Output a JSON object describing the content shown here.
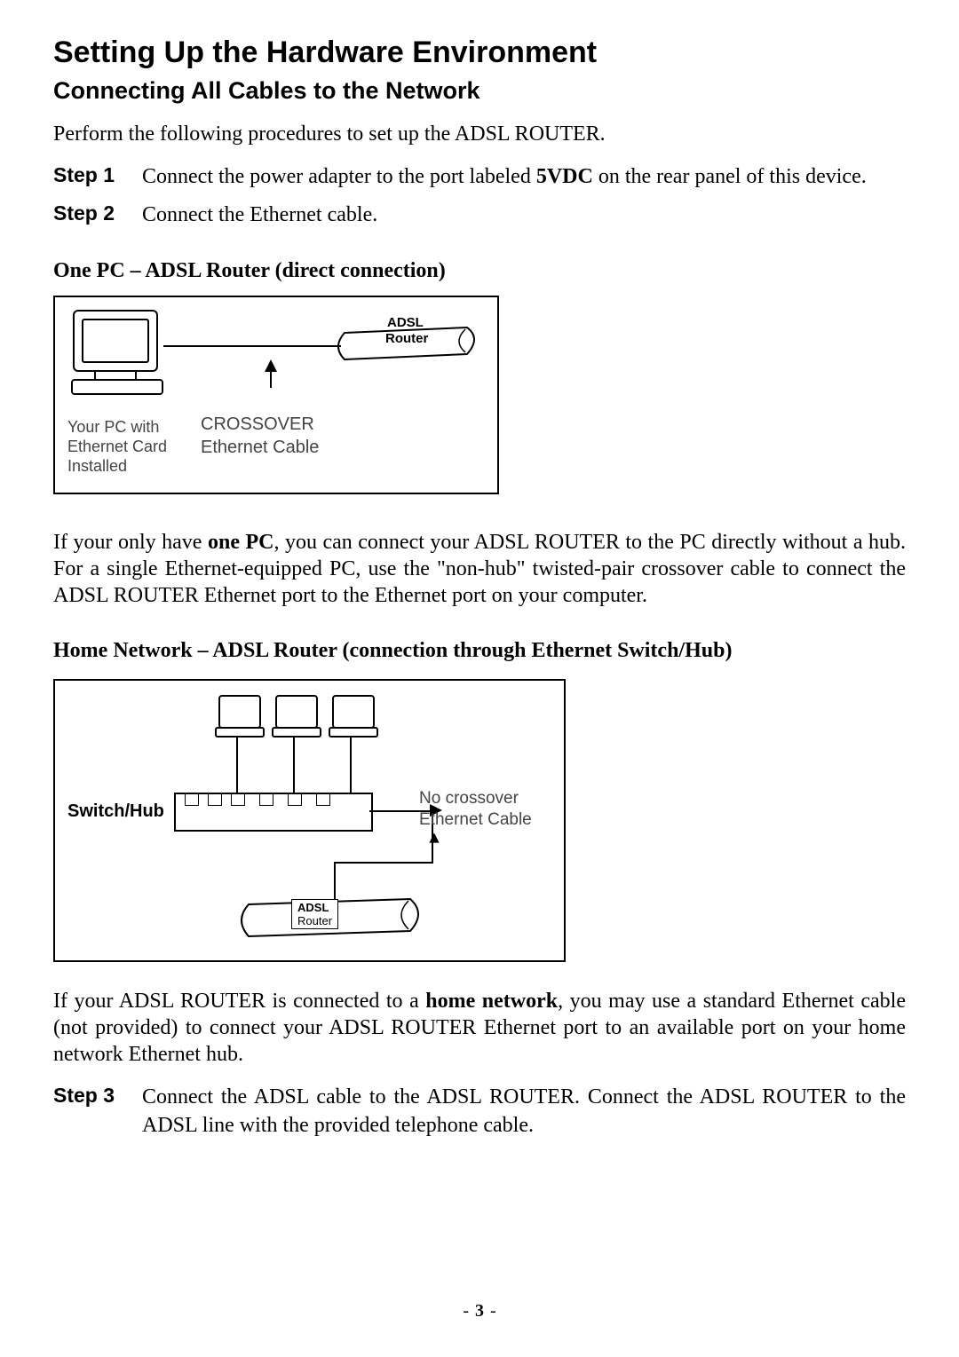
{
  "title": "Setting Up the Hardware Environment",
  "subtitle": "Connecting All Cables to the Network",
  "intro": "Perform the following procedures to set up the ADSL ROUTER.",
  "steps": {
    "s1": {
      "label": "Step 1",
      "text_before": "Connect the power adapter to the port labeled ",
      "bold": "5VDC",
      "text_after": " on the rear panel of this device."
    },
    "s2": {
      "label": "Step 2",
      "text": "Connect the Ethernet cable."
    },
    "s3": {
      "label": "Step 3",
      "text": "Connect the ADSL cable to the ADSL ROUTER. Connect the ADSL ROUTER to the ADSL line with the provided telephone cable."
    }
  },
  "scenario1": {
    "heading": "One PC – ADSL Router (direct connection)",
    "fig": {
      "router_label_top": "ADSL",
      "router_label_bottom": "Router",
      "pc_label_l1": "Your PC with",
      "pc_label_l2": "Ethernet Card",
      "pc_label_l3": "Installed",
      "cable_label_l1": "CROSSOVER",
      "cable_label_l2": "Ethernet Cable"
    },
    "para_before": "If your only have ",
    "para_bold": "one PC",
    "para_after": ", you can connect your ADSL ROUTER to the PC directly without a hub. For a single Ethernet-equipped PC, use the \"non-hub\" twisted-pair crossover cable to connect the ADSL ROUTER Ethernet port to the Ethernet port on your computer."
  },
  "scenario2": {
    "heading": "Home Network – ADSL Router (connection through Ethernet Switch/Hub)",
    "fig": {
      "switch_label": "Switch/Hub",
      "cable_label_l1": "No crossover",
      "cable_label_l2": "Ethernet Cable",
      "router_label_top": "ADSL",
      "router_label_bottom": "Router"
    },
    "para_before": "If your ADSL ROUTER is connected to a ",
    "para_bold": "home network",
    "para_after": ", you may use a standard Ethernet cable (not provided) to connect your ADSL ROUTER Ethernet port to an available port on your home network Ethernet hub."
  },
  "page_number": "3"
}
